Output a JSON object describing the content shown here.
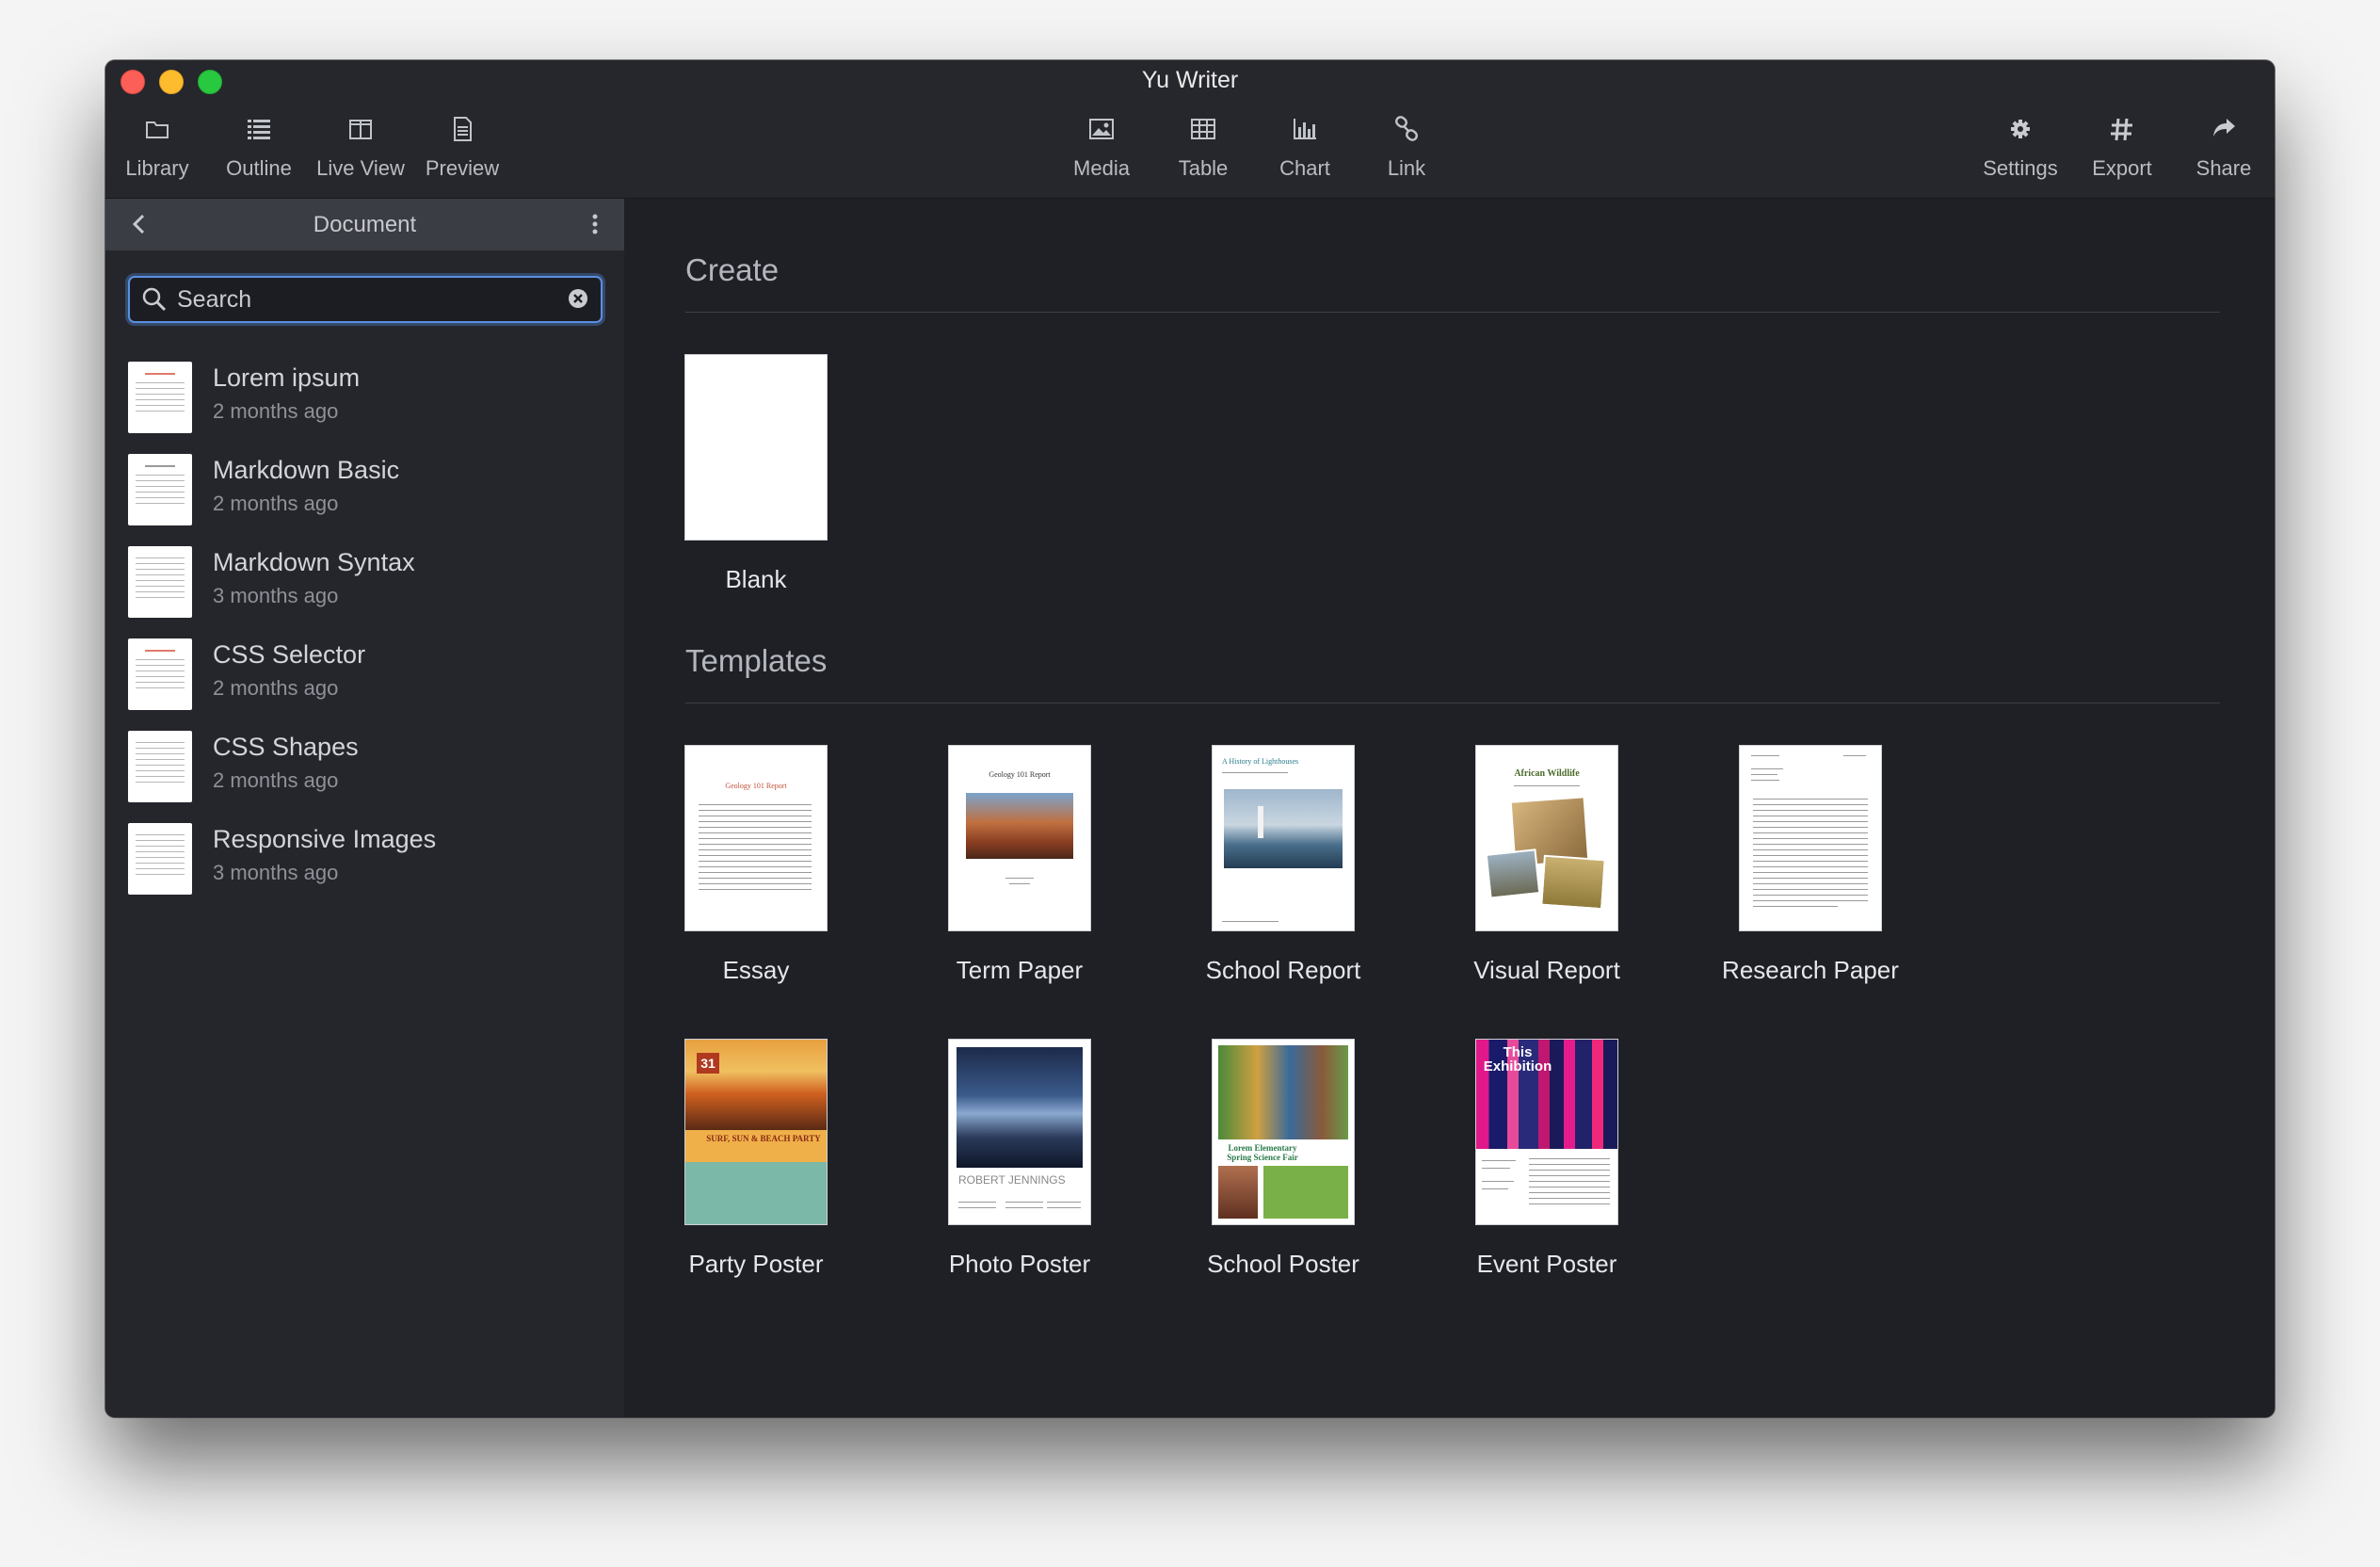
{
  "window": {
    "title": "Yu Writer"
  },
  "toolbar": {
    "left": [
      {
        "label": "Library",
        "icon": "folder-icon"
      },
      {
        "label": "Outline",
        "icon": "list-icon"
      },
      {
        "label": "Live View",
        "icon": "columns-icon"
      },
      {
        "label": "Preview",
        "icon": "document-icon"
      }
    ],
    "center": [
      {
        "label": "Media",
        "icon": "image-icon"
      },
      {
        "label": "Table",
        "icon": "table-icon"
      },
      {
        "label": "Chart",
        "icon": "bar-chart-icon"
      },
      {
        "label": "Link",
        "icon": "link-icon"
      }
    ],
    "right": [
      {
        "label": "Settings",
        "icon": "gear-icon"
      },
      {
        "label": "Export",
        "icon": "hash-icon"
      },
      {
        "label": "Share",
        "icon": "share-icon"
      }
    ]
  },
  "sidebar": {
    "title": "Document",
    "search": {
      "placeholder": "Search",
      "value": ""
    },
    "documents": [
      {
        "name": "Lorem ipsum",
        "date": "2 months ago"
      },
      {
        "name": "Markdown Basic",
        "date": "2 months ago"
      },
      {
        "name": "Markdown Syntax",
        "date": "3 months ago"
      },
      {
        "name": "CSS Selector",
        "date": "2 months ago"
      },
      {
        "name": "CSS Shapes",
        "date": "2 months ago"
      },
      {
        "name": "Responsive Images",
        "date": "3 months ago"
      }
    ]
  },
  "main": {
    "create_title": "Create",
    "blank_label": "Blank",
    "templates_title": "Templates",
    "templates": [
      {
        "label": "Essay",
        "thumb_title": "Geology 101 Report"
      },
      {
        "label": "Term Paper",
        "thumb_title": "Geology 101 Report"
      },
      {
        "label": "School Report",
        "thumb_title": "A History of Lighthouses"
      },
      {
        "label": "Visual Report",
        "thumb_title": "African Wildlife"
      },
      {
        "label": "Research Paper",
        "thumb_title": ""
      },
      {
        "label": "Party Poster",
        "thumb_title": "SURF, SUN & BEACH PARTY",
        "thumb_number": "31"
      },
      {
        "label": "Photo Poster",
        "thumb_title": "ROBERT JENNINGS"
      },
      {
        "label": "School Poster",
        "thumb_title": "Lorem Elementary Spring Science Fair"
      },
      {
        "label": "Event Poster",
        "thumb_title": "This Exhibition"
      }
    ]
  },
  "colors": {
    "window_bg": "#1f2026",
    "toolbar_bg": "#26272c",
    "sidebar_bg": "#25262c",
    "accent": "#5b8fe0",
    "close": "#fc5f57",
    "minimize": "#fdbc2e",
    "maximize": "#28c840"
  }
}
